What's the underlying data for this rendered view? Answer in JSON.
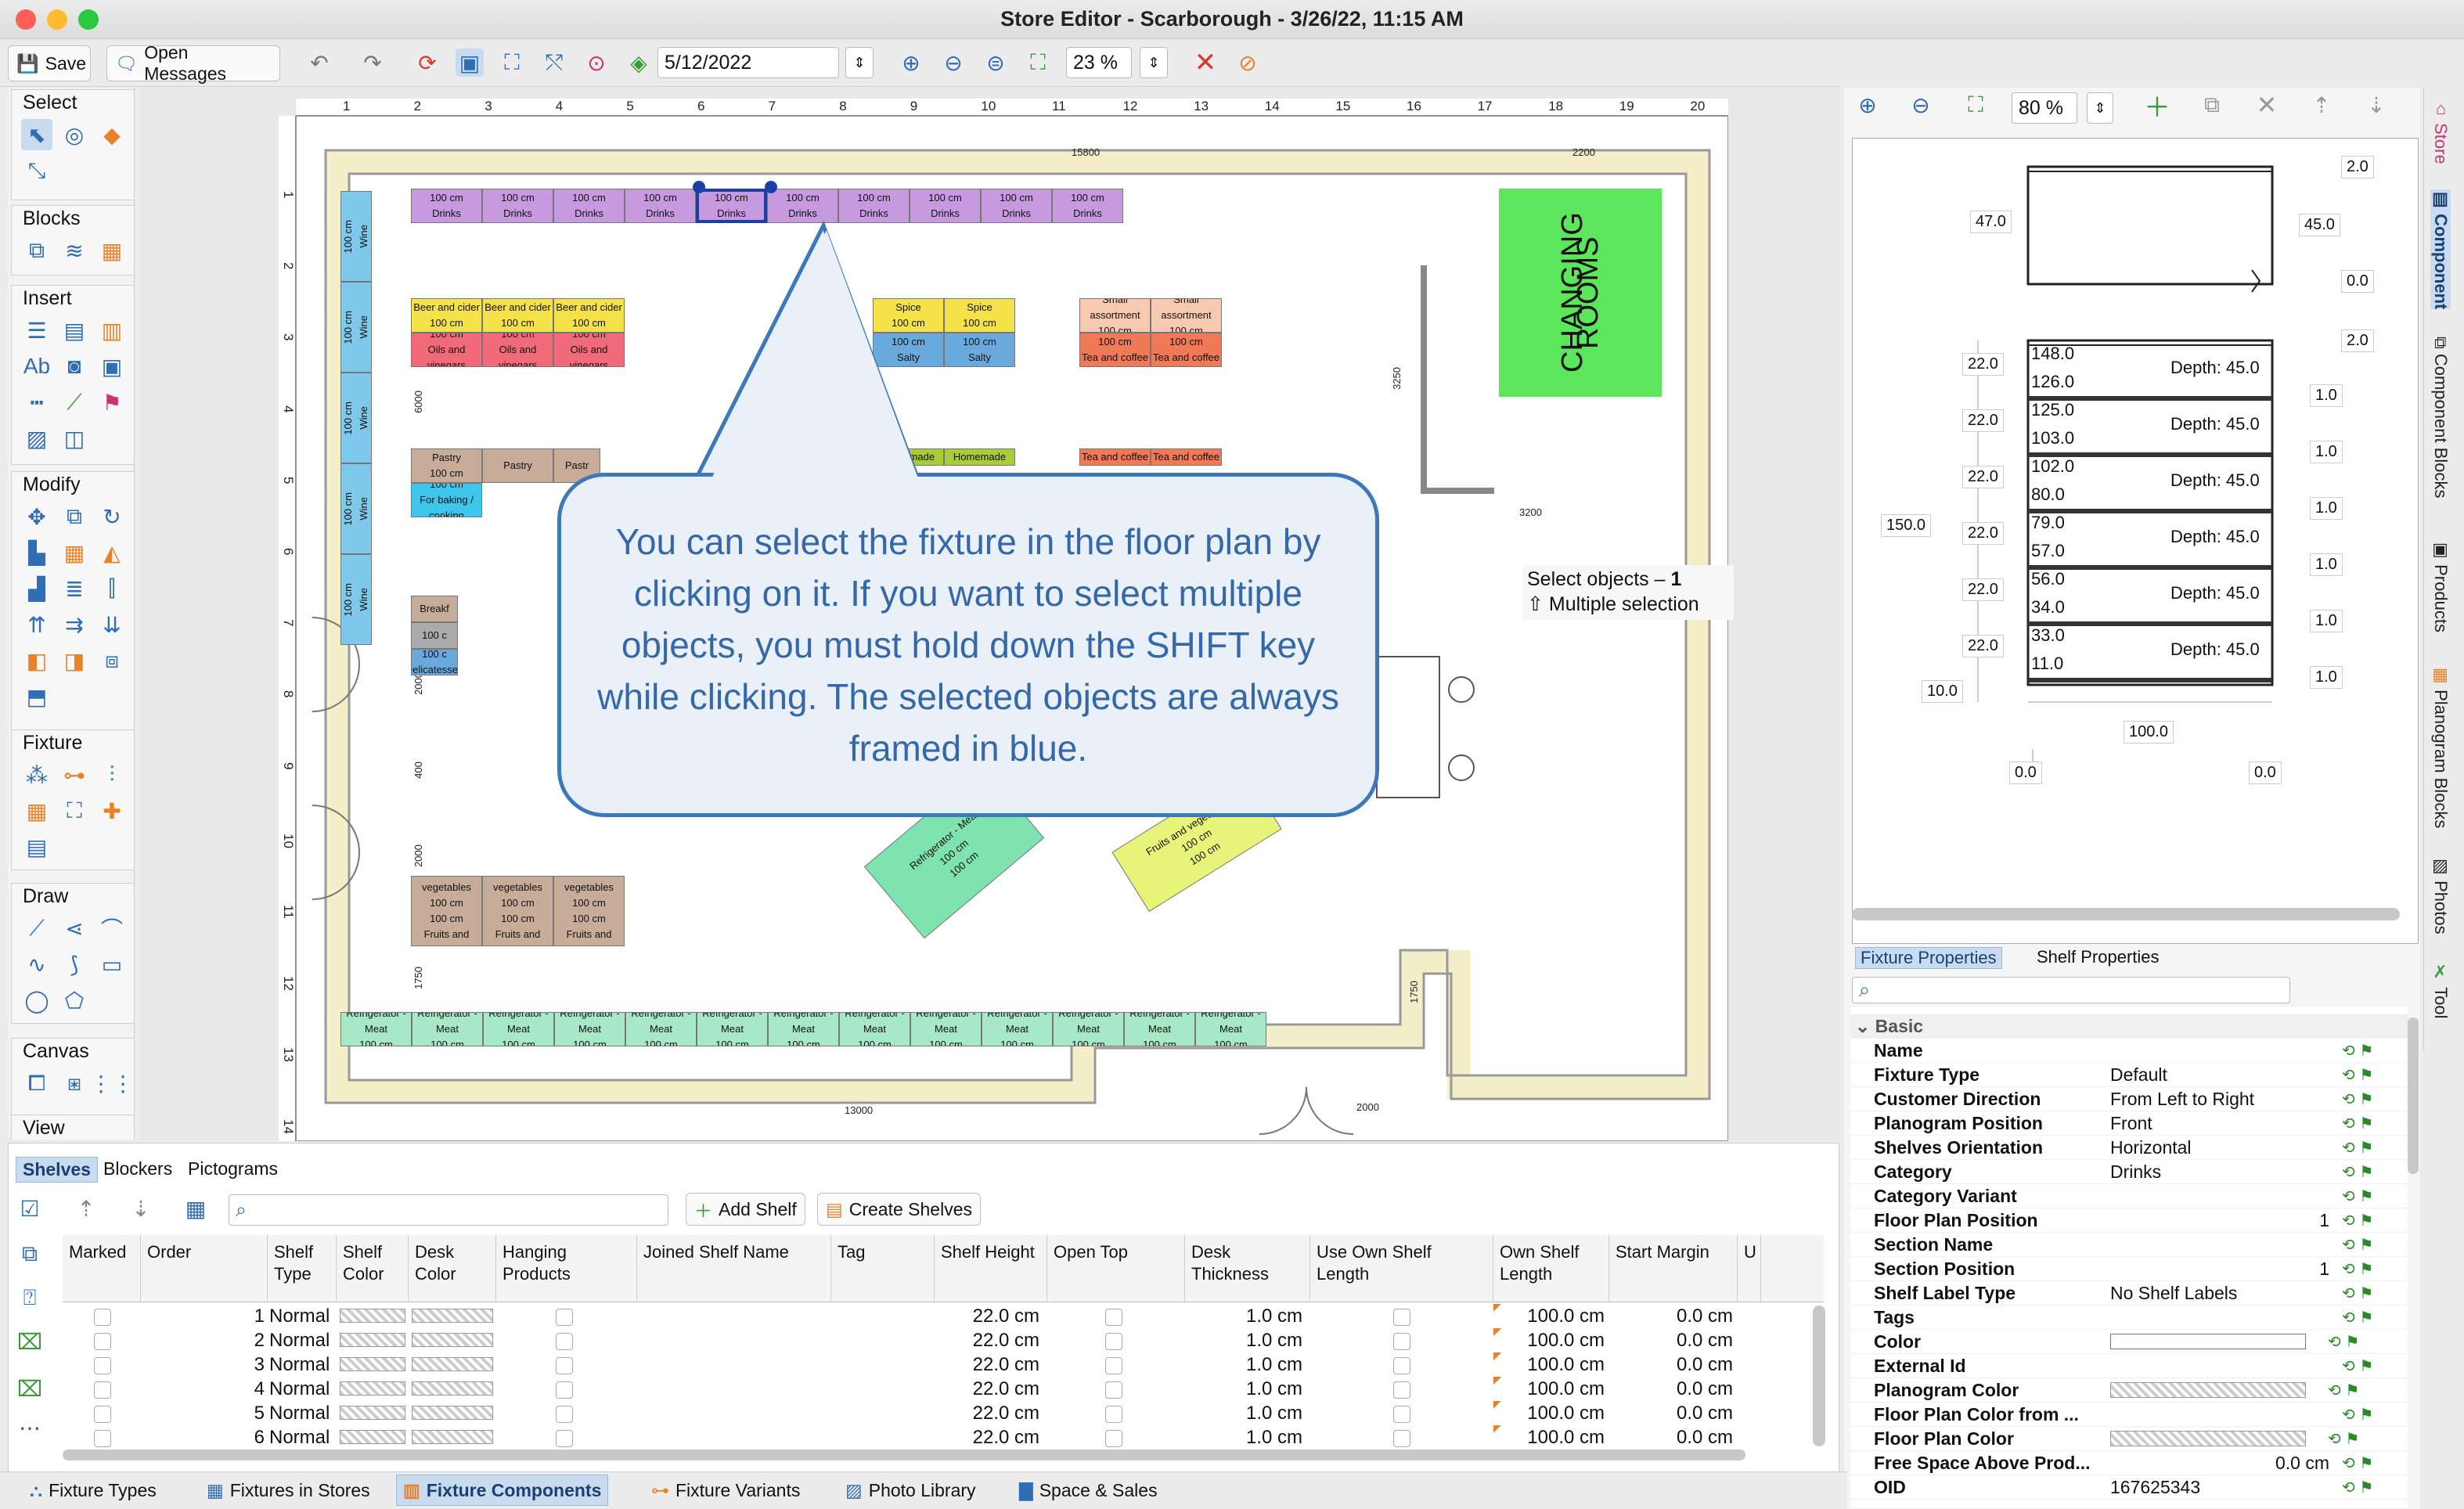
{
  "window": {
    "title": "Store Editor - Scarborough - 3/26/22, 11:15 AM"
  },
  "toolbar": {
    "save": "Save",
    "open_messages": "Open Messages",
    "date": "5/12/2022",
    "zoom": "23 %"
  },
  "left_sections": [
    "Select",
    "Blocks",
    "Insert",
    "Modify",
    "Fixture",
    "Draw",
    "Canvas",
    "View"
  ],
  "ruler": {
    "top": [
      "1",
      "2",
      "3",
      "4",
      "5",
      "6",
      "7",
      "8",
      "9",
      "10",
      "11",
      "12",
      "13",
      "14",
      "15",
      "16",
      "17",
      "18",
      "19",
      "20"
    ],
    "left": [
      "1",
      "2",
      "3",
      "4",
      "5",
      "6",
      "7",
      "8",
      "9",
      "10",
      "11",
      "12",
      "13",
      "14"
    ]
  },
  "floor": {
    "dims": {
      "top_a": "15800",
      "top_b": "2200",
      "bottom_a": "13000",
      "bottom_b": "2000",
      "left_a": "6000",
      "left_b": "2000",
      "left_c": "400",
      "left_d": "2000",
      "left_e": "1750",
      "right_a": "3250",
      "right_b": "3200",
      "right_c": "1750"
    },
    "drinks": {
      "size": "100 cm",
      "cat": "Drinks"
    },
    "wine": {
      "size": "100 cm",
      "cat": "Wine"
    },
    "beer": {
      "cat": "Beer and cider",
      "size": "100 cm",
      "cat2": "Oils and vinegars"
    },
    "spice": {
      "cat": "Spice",
      "size": "100 cm",
      "cat2": "Salty"
    },
    "small": {
      "cat": "Small assortment",
      "size": "100 cm",
      "cat2": "Tea and coffee"
    },
    "pastry": {
      "cat": "Pastry",
      "size": "100 cm",
      "cat_short": "Pastr",
      "cat2": "For baking / cooking"
    },
    "homemade": {
      "cat": "Homemade"
    },
    "tea": {
      "cat": "Tea and coffee"
    },
    "breakfast": {
      "cat": "Breakf",
      "size": "100 c",
      "cat2": "Delicatessen"
    },
    "fruits": {
      "cat": "Fruits and vegetables",
      "size": "100 cm"
    },
    "fridge": {
      "cat": "Refrigerator - Meat",
      "size": "100 cm"
    },
    "changing_rooms": "CHANGING ROOMS"
  },
  "callout": {
    "text": "You can select the fixture in the floor plan by clicking on it. If you want to select multiple objects, you must hold down the SHIFT key while clicking. The selected objects are always framed in blue."
  },
  "tooltip": {
    "line1": "Select objects –",
    "count": "1",
    "line2": "Multiple selection"
  },
  "right_toolbar": {
    "zoom": "80 %"
  },
  "side_tabs": [
    "Store",
    "Component",
    "Component Blocks",
    "Products",
    "Planogram Blocks",
    "Photos",
    "Tool"
  ],
  "shelf_diagram": {
    "top_labels": {
      "a": "2.0",
      "b": "47.0",
      "c": "45.0",
      "d": "0.0",
      "e": "2.0"
    },
    "rows": [
      {
        "top": "148.0",
        "bottom": "126.0",
        "left": "22.0",
        "depth": "Depth: 45.0",
        "right": "1.0"
      },
      {
        "top": "125.0",
        "bottom": "103.0",
        "left": "22.0",
        "depth": "Depth: 45.0",
        "right": "1.0"
      },
      {
        "top": "102.0",
        "bottom": "80.0",
        "left": "22.0",
        "depth": "Depth: 45.0",
        "right": "1.0"
      },
      {
        "top": "79.0",
        "bottom": "57.0",
        "left": "22.0",
        "depth": "Depth: 45.0",
        "right": "1.0"
      },
      {
        "top": "56.0",
        "bottom": "34.0",
        "left": "22.0",
        "depth": "Depth: 45.0",
        "right": "1.0"
      },
      {
        "top": "33.0",
        "bottom": "11.0",
        "left": "22.0",
        "depth": "Depth: 45.0",
        "right": "1.0"
      }
    ],
    "height": "150.0",
    "base": "10.0",
    "width": "100.0",
    "bl": "0.0",
    "br": "0.0"
  },
  "prop_tabs": {
    "fixture": "Fixture Properties",
    "shelf": "Shelf Properties"
  },
  "props": {
    "group": "Basic",
    "rows": [
      {
        "name": "Name",
        "value": ""
      },
      {
        "name": "Fixture Type",
        "value": "Default"
      },
      {
        "name": "Customer Direction",
        "value": "From Left to Right"
      },
      {
        "name": "Planogram Position",
        "value": "Front"
      },
      {
        "name": "Shelves Orientation",
        "value": "Horizontal"
      },
      {
        "name": "Category",
        "value": "Drinks"
      },
      {
        "name": "Category Variant",
        "value": ""
      },
      {
        "name": "Floor Plan Position",
        "value": "1"
      },
      {
        "name": "Section Name",
        "value": ""
      },
      {
        "name": "Section Position",
        "value": "1"
      },
      {
        "name": "Shelf Label Type",
        "value": "No Shelf Labels"
      },
      {
        "name": "Tags",
        "value": ""
      },
      {
        "name": "Color",
        "value": ""
      },
      {
        "name": "External Id",
        "value": ""
      },
      {
        "name": "Planogram Color",
        "value": ""
      },
      {
        "name": "Floor Plan Color from ...",
        "value": ""
      },
      {
        "name": "Floor Plan Color",
        "value": ""
      },
      {
        "name": "Free Space Above Prod...",
        "value": "0.0 cm"
      },
      {
        "name": "OID",
        "value": "167625343"
      }
    ]
  },
  "bottom_tabs": [
    "Shelves",
    "Blockers",
    "Pictograms"
  ],
  "shelf_toolbar": {
    "add": "Add Shelf",
    "create": "Create Shelves"
  },
  "grid": {
    "headers": [
      "Marked",
      "Order",
      "Shelf Type",
      "Shelf Color",
      "Desk Color",
      "Hanging Products",
      "Joined Shelf Name",
      "Tag",
      "Shelf Height",
      "Open Top",
      "Desk Thickness",
      "Use Own Shelf Length",
      "Own Shelf Length",
      "Start Margin",
      "U"
    ],
    "rows": [
      {
        "order": "1",
        "type": "Normal",
        "height": "22.0 cm",
        "thick": "1.0 cm",
        "len": "100.0 cm",
        "margin": "0.0 cm"
      },
      {
        "order": "2",
        "type": "Normal",
        "height": "22.0 cm",
        "thick": "1.0 cm",
        "len": "100.0 cm",
        "margin": "0.0 cm"
      },
      {
        "order": "3",
        "type": "Normal",
        "height": "22.0 cm",
        "thick": "1.0 cm",
        "len": "100.0 cm",
        "margin": "0.0 cm"
      },
      {
        "order": "4",
        "type": "Normal",
        "height": "22.0 cm",
        "thick": "1.0 cm",
        "len": "100.0 cm",
        "margin": "0.0 cm"
      },
      {
        "order": "5",
        "type": "Normal",
        "height": "22.0 cm",
        "thick": "1.0 cm",
        "len": "100.0 cm",
        "margin": "0.0 cm"
      },
      {
        "order": "6",
        "type": "Normal",
        "height": "22.0 cm",
        "thick": "1.0 cm",
        "len": "100.0 cm",
        "margin": "0.0 cm"
      }
    ]
  },
  "status_tabs": [
    "Fixture Types",
    "Fixtures in Stores",
    "Fixture Components",
    "Fixture Variants",
    "Photo Library",
    "Space & Sales"
  ]
}
